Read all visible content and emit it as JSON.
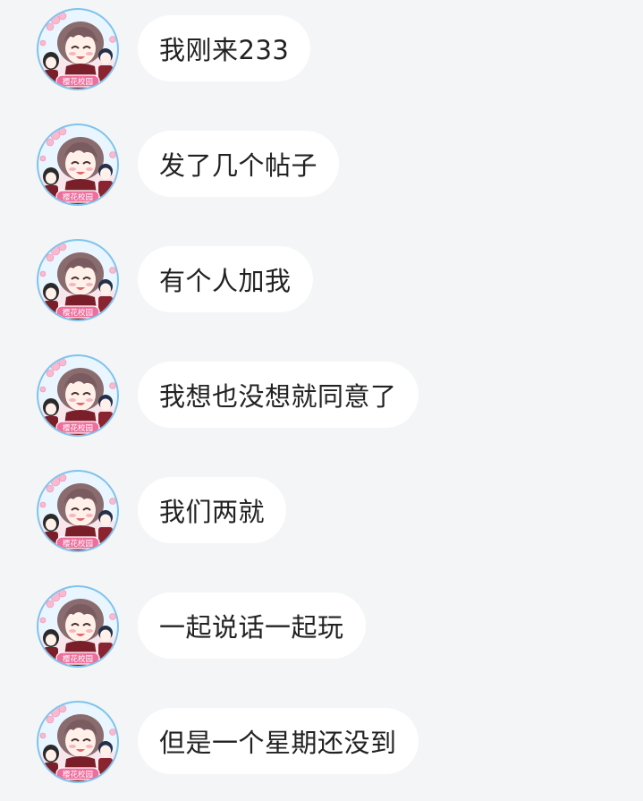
{
  "theme": {
    "background": "#f4f5f7",
    "bubble": "#ffffff",
    "text": "#222222",
    "avatar_ring": "#7fc3ec",
    "badge": "#ee6f9d"
  },
  "avatar": {
    "badge_text": "樱花校园",
    "icon": "anime-avatar-icon"
  },
  "messages": [
    {
      "text": "我刚来233"
    },
    {
      "text": "发了几个帖子"
    },
    {
      "text": "有个人加我"
    },
    {
      "text": "我想也没想就同意了"
    },
    {
      "text": "我们两就"
    },
    {
      "text": "一起说话一起玩"
    },
    {
      "text": "但是一个星期还没到"
    }
  ]
}
